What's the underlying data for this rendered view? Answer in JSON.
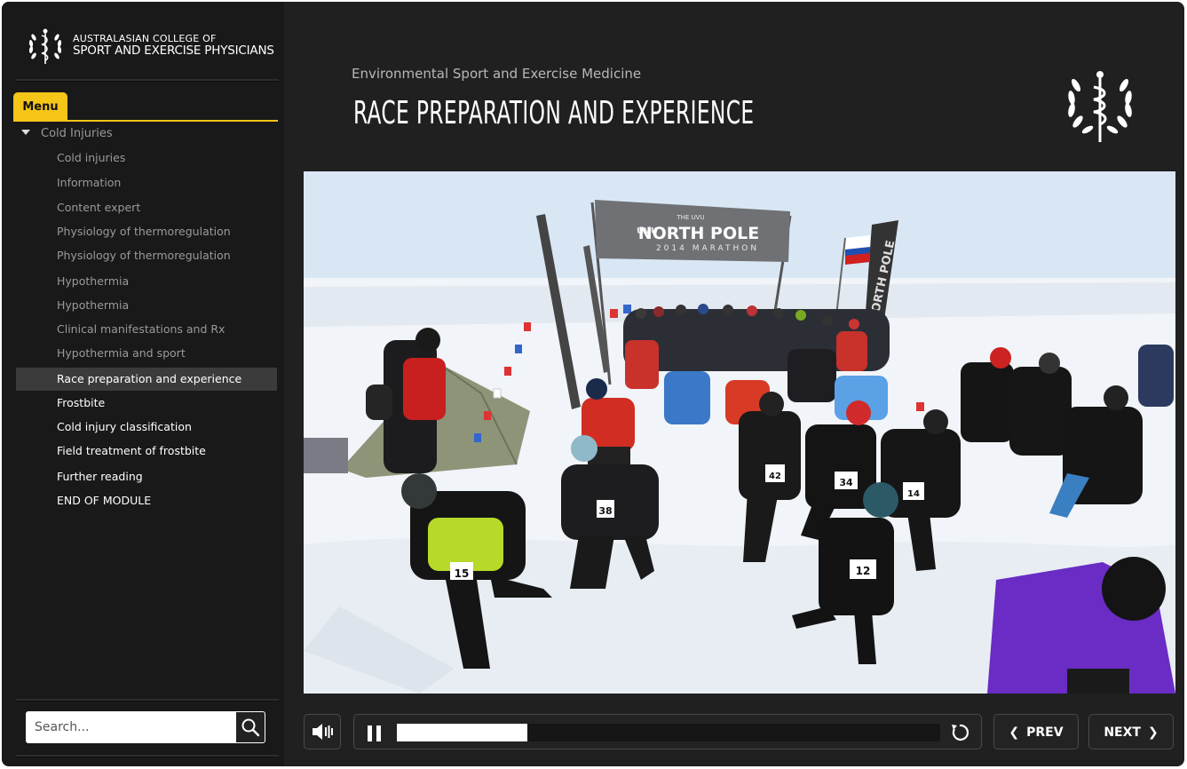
{
  "org": {
    "name_line1": "AUSTRALASIAN COLLEGE OF",
    "name_line2": "SPORT AND EXERCISE PHYSICIANS"
  },
  "sidebar": {
    "menu_label": "Menu",
    "section_label": "Cold Injuries",
    "items": [
      {
        "label": "Cold injuries"
      },
      {
        "label": "Information"
      },
      {
        "label": "Content expert"
      },
      {
        "label": "Physiology of thermoregulation"
      },
      {
        "label": "Physiology of thermoregulation"
      },
      {
        "label": "Hypothermia"
      },
      {
        "label": "Hypothermia"
      },
      {
        "label": "Clinical manifestations and Rx"
      },
      {
        "label": "Hypothermia and sport"
      },
      {
        "label": "Race preparation and experience"
      },
      {
        "label": "Frostbite"
      },
      {
        "label": "Cold injury classification"
      },
      {
        "label": "Field treatment of frostbite"
      },
      {
        "label": "Further reading"
      },
      {
        "label": "END OF MODULE"
      }
    ],
    "search_placeholder": "Search..."
  },
  "header": {
    "course_title": "Environmental Sport and Exercise Medicine",
    "slide_title": "RACE PREPARATION AND EXPERIENCE"
  },
  "photo": {
    "banner_text": "NORTH POLE",
    "banner_brand": "UVU",
    "banner_small": "THE UVU",
    "banner_year": "2014 MARATHON",
    "side_flag_text": "NORTH POLE",
    "bibs": [
      "38",
      "15",
      "34",
      "12",
      "42",
      "14"
    ]
  },
  "controls": {
    "prev_label": "PREV",
    "next_label": "NEXT",
    "progress": 0.24,
    "icons": [
      "volume-icon",
      "pause-icon",
      "replay-icon",
      "chevron-left-icon",
      "chevron-right-icon",
      "search-icon"
    ]
  }
}
